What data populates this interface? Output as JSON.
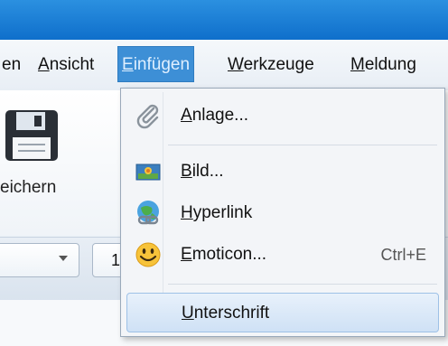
{
  "menubar": {
    "items": [
      {
        "pre": "",
        "u": "",
        "post": "en"
      },
      {
        "pre": "",
        "u": "A",
        "post": "nsicht"
      },
      {
        "pre": "",
        "u": "E",
        "post": "infügen"
      },
      {
        "pre": "",
        "u": "W",
        "post": "erkzeuge"
      },
      {
        "pre": "",
        "u": "M",
        "post": "eldung"
      }
    ]
  },
  "toolbar": {
    "save_label": "eichern",
    "size_value": "1"
  },
  "insert_menu": {
    "items": [
      {
        "u": "A",
        "rest": "nlage...",
        "shortcut": "",
        "icon": "paperclip-icon"
      },
      {
        "u": "B",
        "rest": "ild...",
        "shortcut": "",
        "icon": "picture-icon"
      },
      {
        "u": "H",
        "rest": "yperlink",
        "shortcut": "",
        "icon": "globe-link-icon"
      },
      {
        "u": "E",
        "rest": "moticon...",
        "shortcut": "Ctrl+E",
        "icon": "smiley-icon"
      },
      {
        "u": "U",
        "rest": "nterschrift",
        "shortcut": "",
        "icon": ""
      }
    ]
  },
  "colors": {
    "titlebar": "#1a7fd8",
    "active_menu": "#3d8fd6",
    "highlight": "#cfe1f5"
  }
}
